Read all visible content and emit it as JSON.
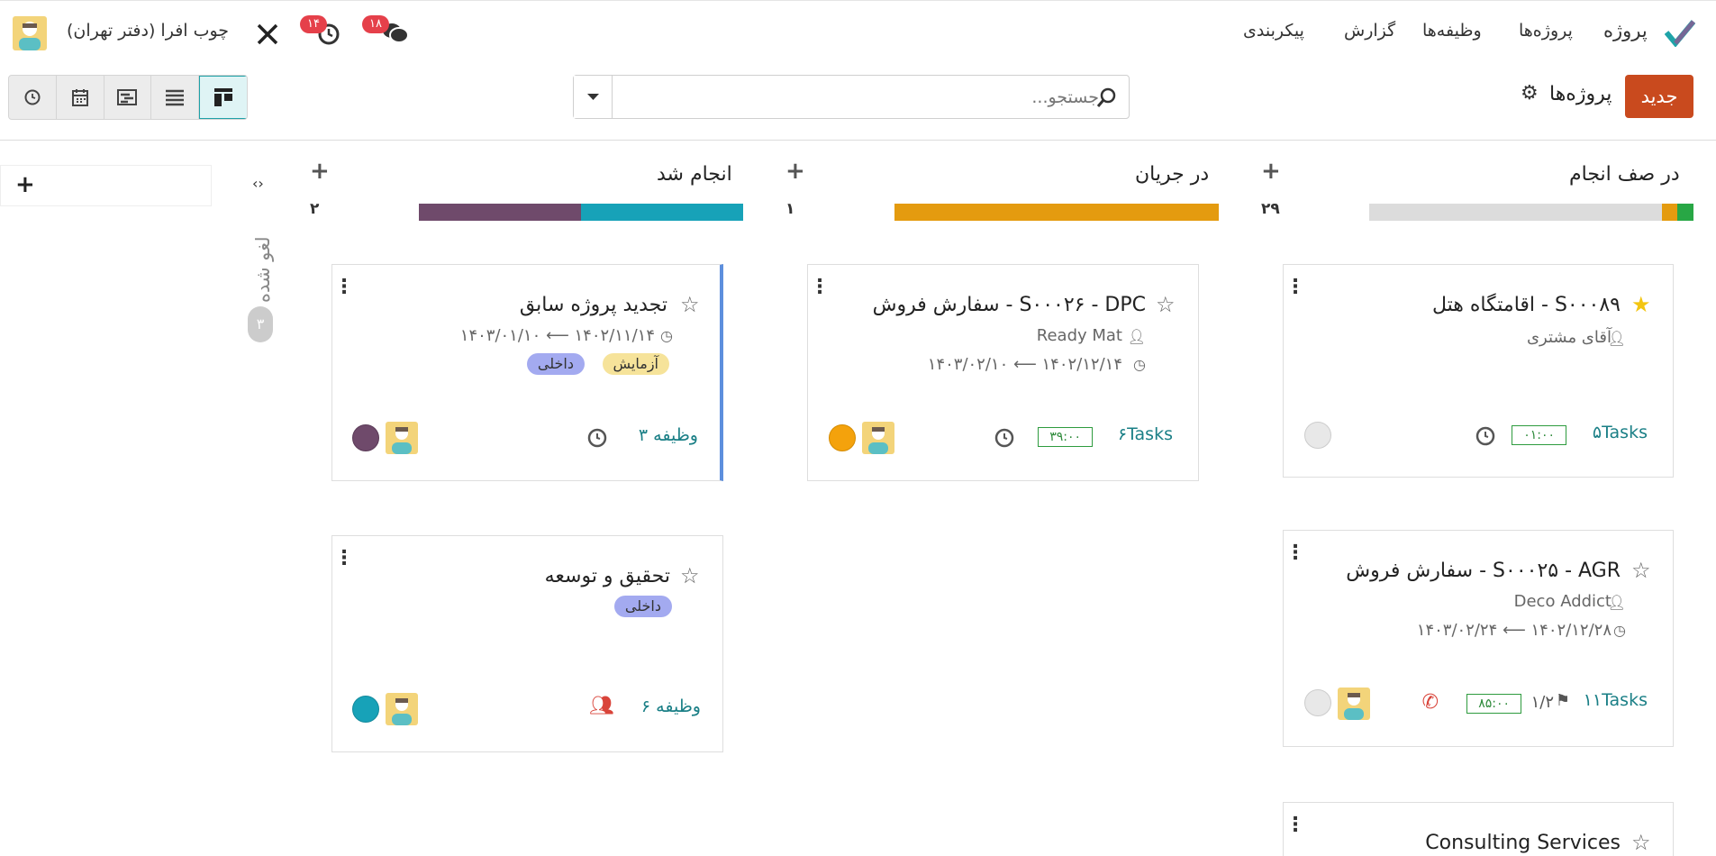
{
  "navbar": {
    "app_name": "پروژه",
    "menu": [
      "پروژه‌ها",
      "وظیفه‌ها",
      "گزارش",
      "پیکربندی"
    ],
    "company": "چوب افرا (دفتر تهران)",
    "messages_badge": "۱۸",
    "activities_badge": "۱۴"
  },
  "control": {
    "new_label": "جدید",
    "breadcrumb": "پروژه‌ها",
    "search_placeholder": "جستجو..."
  },
  "columns": [
    {
      "title": "در صف انجام",
      "count": "۲۹"
    },
    {
      "title": "در جریان",
      "count": "۱"
    },
    {
      "title": "انجام شد",
      "count": "۲"
    }
  ],
  "folded_column": {
    "title": "لغو شده",
    "count": "۳"
  },
  "cards": [
    {
      "title": "S۰۰۰۸۹ - اقامتگاه هتل",
      "customer": "آقای مشتری",
      "tasks": "۵Tasks",
      "time": "۰۱:۰۰",
      "favorite": true
    },
    {
      "title": "S۰۰۰۲۵ - AGR - سفارش فروش",
      "customer": "Deco Addict",
      "dates": "۱۴۰۲/۱۲/۲۸ ⟵ ۱۴۰۳/۰۲/۲۴",
      "tasks": "۱۱Tasks",
      "milestone": "۱/۲",
      "time": "۸۵:۰۰"
    },
    {
      "title": "Consulting Services"
    },
    {
      "title": "S۰۰۰۲۶ - DPC - سفارش فروش",
      "customer": "Ready Mat",
      "dates": "۱۴۰۲/۱۲/۱۴ ⟵ ۱۴۰۳/۰۲/۱۰",
      "tasks": "۶Tasks",
      "time": "۳۹:۰۰"
    },
    {
      "title": "تجدید پروژه سابق",
      "dates": "۱۴۰۲/۱۱/۱۴ ⟵ ۱۴۰۳/۰۱/۱۰",
      "tags": [
        "آزمایش",
        "داخلی"
      ],
      "tasks": "۳ وظیفه"
    },
    {
      "title": "تحقیق و توسعه",
      "tags": [
        "داخلی"
      ],
      "tasks": "۶ وظیفه"
    }
  ],
  "colors": {
    "accent": "#c94a1e",
    "teal": "#1a7f86",
    "progress_orange": "#e49b0f",
    "progress_purple": "#6f4a6b",
    "progress_teal": "#17a2b8",
    "tag_yellow": "#f6e39a",
    "tag_purple": "#a3aaf0"
  }
}
